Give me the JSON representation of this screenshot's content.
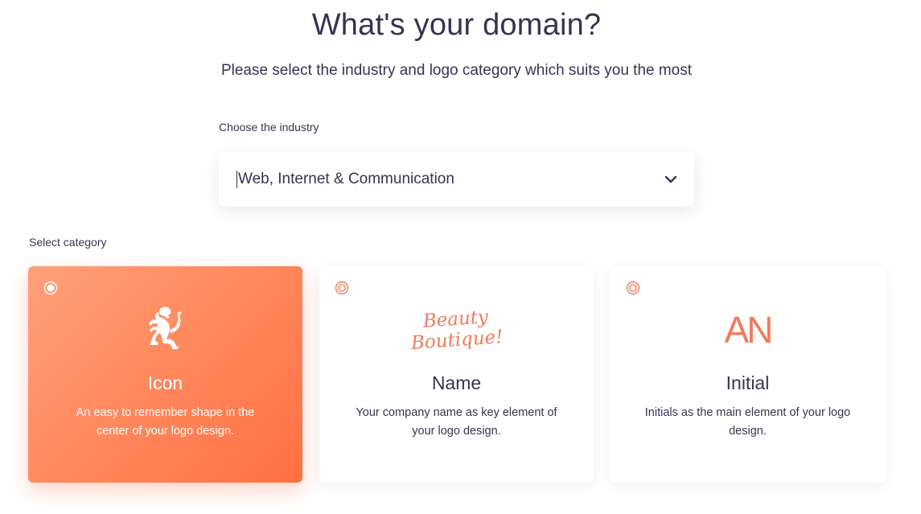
{
  "header": {
    "title": "What's your domain?",
    "subtitle": "Please select the industry and logo category which suits you the most"
  },
  "industry": {
    "label": "Choose the industry",
    "selected_value": "Web, Internet & Communication",
    "icon": "chevron-down-icon"
  },
  "category": {
    "label": "Select category",
    "options": [
      {
        "title": "Icon",
        "description": "An easy to remember shape in the center of your logo design.",
        "selected": true,
        "art": "lion-icon"
      },
      {
        "title": "Name",
        "description": "Your company name as key element of your logo design.",
        "selected": false,
        "art_lines": [
          "Beauty",
          "Boutique!"
        ]
      },
      {
        "title": "Initial",
        "description": "Initials as the main element of your logo design.",
        "selected": false,
        "art_text": "AN"
      }
    ]
  },
  "colors": {
    "text": "#3a3252",
    "accent": "#ff7043",
    "accent_light": "#ffa07a",
    "logo_orange": "#f27b5a"
  }
}
